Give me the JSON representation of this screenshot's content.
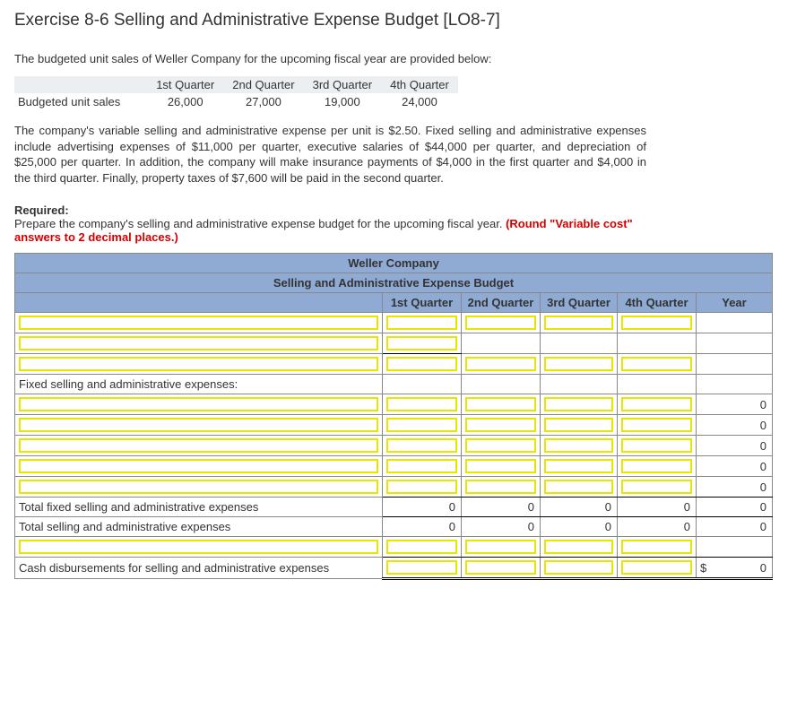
{
  "title": "Exercise 8-6 Selling and Administrative Expense Budget [LO8-7]",
  "intro": "The budgeted unit sales of Weller Company for the upcoming fiscal year are provided below:",
  "sales_table": {
    "row_label": "Budgeted unit sales",
    "headers": [
      "1st Quarter",
      "2nd Quarter",
      "3rd Quarter",
      "4th Quarter"
    ],
    "values": [
      "26,000",
      "27,000",
      "19,000",
      "24,000"
    ]
  },
  "body_text": "The company's variable selling and administrative expense per unit is $2.50. Fixed selling and administrative expenses include advertising expenses of $11,000 per quarter, executive salaries of $44,000 per quarter, and depreciation of $25,000 per quarter. In addition, the company will make insurance payments of $4,000 in the first quarter and $4,000 in the third quarter. Finally, property taxes of $7,600 will be paid in the second quarter.",
  "required_label": "Required:",
  "required_text": "Prepare the company's selling and administrative expense budget for the upcoming fiscal year. ",
  "round_note": "(Round \"Variable cost\" answers to 2 decimal places.)",
  "budget": {
    "company": "Weller  Company",
    "subtitle": "Selling and Administrative Expense Budget",
    "cols": [
      "1st Quarter",
      "2nd Quarter",
      "3rd Quarter",
      "4th Quarter",
      "Year"
    ],
    "fixed_header": "Fixed selling and administrative expenses:",
    "total_fixed": "Total fixed selling and administrative expenses",
    "total_sa": "Total selling and administrative expenses",
    "cash_disb": "Cash disbursements for selling and administrative expenses",
    "zero": "0",
    "dollar": "$"
  }
}
